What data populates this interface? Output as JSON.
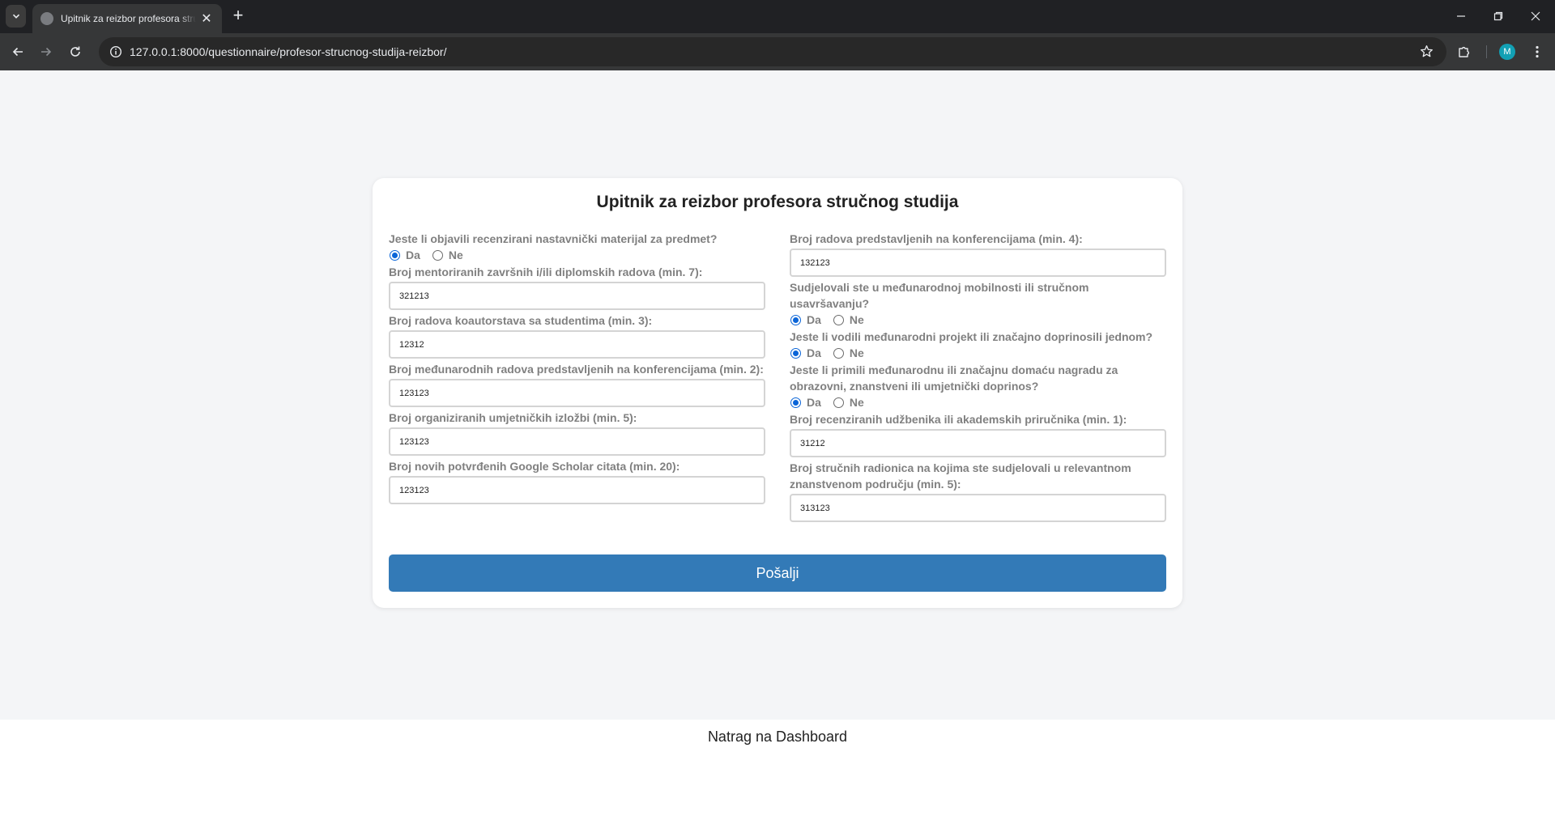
{
  "browser": {
    "tab_title": "Upitnik za reizbor profesora stručnog studija",
    "url": "127.0.0.1:8000/questionnaire/profesor-strucnog-studija-reizbor/",
    "avatar_letter": "M"
  },
  "form": {
    "title": "Upitnik za reizbor profesora stručnog studija",
    "radio_yes": "Da",
    "radio_no": "Ne",
    "left": [
      {
        "label": "Jeste li objavili recenzirani nastavnički materijal za predmet?",
        "type": "radio",
        "selected": "Da"
      },
      {
        "label": "Broj mentoriranih završnih i/ili diplomskih radova (min. 7):",
        "type": "number",
        "value": "321213"
      },
      {
        "label": "Broj radova koautorstava sa studentima (min. 3):",
        "type": "number",
        "value": "12312"
      },
      {
        "label": "Broj međunarodnih radova predstavljenih na konferencijama (min. 2):",
        "type": "number",
        "value": "123123"
      },
      {
        "label": "Broj organiziranih umjetničkih izložbi (min. 5):",
        "type": "number",
        "value": "123123"
      },
      {
        "label": "Broj novih potvrđenih Google Scholar citata (min. 20):",
        "type": "number",
        "value": "123123"
      }
    ],
    "right": [
      {
        "label": "Broj radova predstavljenih na konferencijama (min. 4):",
        "type": "number",
        "value": "132123"
      },
      {
        "label": "Sudjelovali ste u međunarodnoj mobilnosti ili stručnom usavršavanju?",
        "type": "radio",
        "selected": "Da"
      },
      {
        "label": "Jeste li vodili međunarodni projekt ili značajno doprinosili jednom?",
        "type": "radio",
        "selected": "Da"
      },
      {
        "label": "Jeste li primili međunarodnu ili značajnu domaću nagradu za obrazovni, znanstveni ili umjetnički doprinos?",
        "type": "radio",
        "selected": "Da"
      },
      {
        "label": "Broj recenziranih udžbenika ili akademskih priručnika (min. 1):",
        "type": "number",
        "value": "31212"
      },
      {
        "label": "Broj stručnih radionica na kojima ste sudjelovali u relevantnom znanstvenom području (min. 5):",
        "type": "number",
        "value": "313123"
      }
    ],
    "submit_label": "Pošalji"
  },
  "footer": {
    "back_link": "Natrag na Dashboard"
  },
  "colors": {
    "accent": "#337ab7",
    "radio_selected": "#0b65d8",
    "page_bg": "#f4f5f7",
    "label_gray": "#808080"
  }
}
